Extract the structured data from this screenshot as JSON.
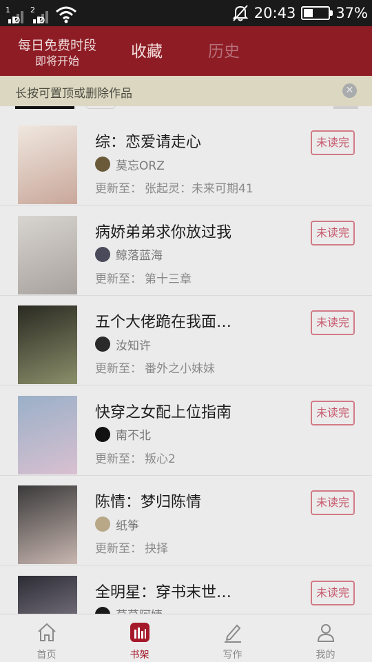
{
  "status_bar": {
    "sim1_label": "1",
    "sim2_label": "2",
    "time": "20:43",
    "battery_percent": "37%",
    "battery_level": 0.37,
    "icons": [
      "signal-icon",
      "signal-icon",
      "wifi-icon",
      "mute-bell-icon",
      "battery-charging-icon"
    ]
  },
  "header": {
    "promo_line1": "每日免费时段",
    "promo_line2": "即将开始",
    "tabs": [
      {
        "label": "收藏",
        "active": true
      },
      {
        "label": "历史",
        "active": false
      }
    ]
  },
  "tip": {
    "text": "长按可置顶或删除作品",
    "close_icon": "close-icon"
  },
  "update_prefix": "更新至：",
  "books": [
    {
      "title": "综：恋爱请走心",
      "author": "莫忘ORZ",
      "latest": "张起灵：未来可期41",
      "badge": "未读完",
      "cover_colors": [
        "#efe7df",
        "#c9a79a"
      ],
      "avatar_color": "#6b5a3a"
    },
    {
      "title": "病娇弟弟求你放过我",
      "author": "鲸落蓝海",
      "latest": "第十三章",
      "badge": "未读完",
      "cover_colors": [
        "#d8d4d0",
        "#a8a29e"
      ],
      "avatar_color": "#4a4a5a"
    },
    {
      "title": "五个大佬跪在我面…",
      "author": "汝知许",
      "latest": "番外之小妹妹",
      "badge": "未读完",
      "cover_colors": [
        "#2a2a22",
        "#8a8f6a"
      ],
      "avatar_color": "#2a2a2a"
    },
    {
      "title": "快穿之女配上位指南",
      "author": "南不北",
      "latest": "叛心2",
      "badge": "未读完",
      "cover_colors": [
        "#9ab0c8",
        "#d8c0d0"
      ],
      "avatar_color": "#111111"
    },
    {
      "title": "陈情：梦归陈情",
      "author": "纸筝",
      "latest": "抉择",
      "badge": "未读完",
      "cover_colors": [
        "#3a3a3a",
        "#c8b6b0"
      ],
      "avatar_color": "#b8a888"
    },
    {
      "title": "全明星：穿书末世…",
      "author": "草草阿婕",
      "latest": "",
      "badge": "未读完",
      "cover_colors": [
        "#2c2c34",
        "#9a92a0"
      ],
      "avatar_color": "#1a1a1a"
    }
  ],
  "nav": {
    "items": [
      {
        "label": "首页",
        "icon": "home-icon",
        "active": false
      },
      {
        "label": "书架",
        "icon": "bookshelf-icon",
        "active": true
      },
      {
        "label": "写作",
        "icon": "pen-icon",
        "active": false
      },
      {
        "label": "我的",
        "icon": "user-icon",
        "active": false
      }
    ],
    "accent_color": "#a51a2a"
  }
}
